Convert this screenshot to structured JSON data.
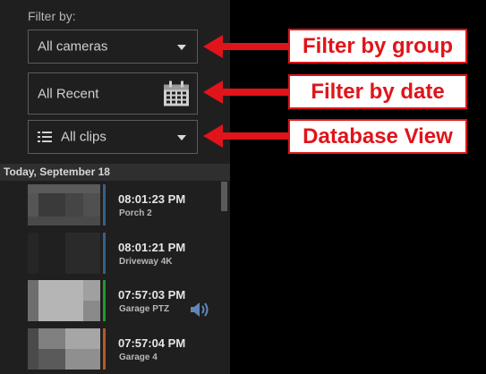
{
  "filter": {
    "title": "Filter by:",
    "group_value": "All cameras",
    "date_value": "All Recent",
    "view_value": "All clips"
  },
  "clips": {
    "date_header": "Today, September 18",
    "items": [
      {
        "time": "08:01:23 PM",
        "camera": "Porch 2",
        "bar_color": "#3a5e8c",
        "has_audio": false
      },
      {
        "time": "08:01:21 PM",
        "camera": "Driveway 4K",
        "bar_color": "#3a5e8c",
        "has_audio": false
      },
      {
        "time": "07:57:03 PM",
        "camera": "Garage PTZ",
        "bar_color": "#1f9a2e",
        "has_audio": true
      },
      {
        "time": "07:57:04 PM",
        "camera": "Garage 4",
        "bar_color": "#b8572a",
        "has_audio": false
      }
    ]
  },
  "annotations": {
    "group": "Filter by group",
    "date": "Filter by date",
    "view": "Database View"
  },
  "colors": {
    "annotation_red": "#e0141a",
    "panel_bg": "#1f1f1f"
  },
  "icons": {
    "calendar": "calendar-icon",
    "list": "list-icon",
    "dropdown": "chevron-down-icon",
    "speaker": "speaker-icon"
  }
}
